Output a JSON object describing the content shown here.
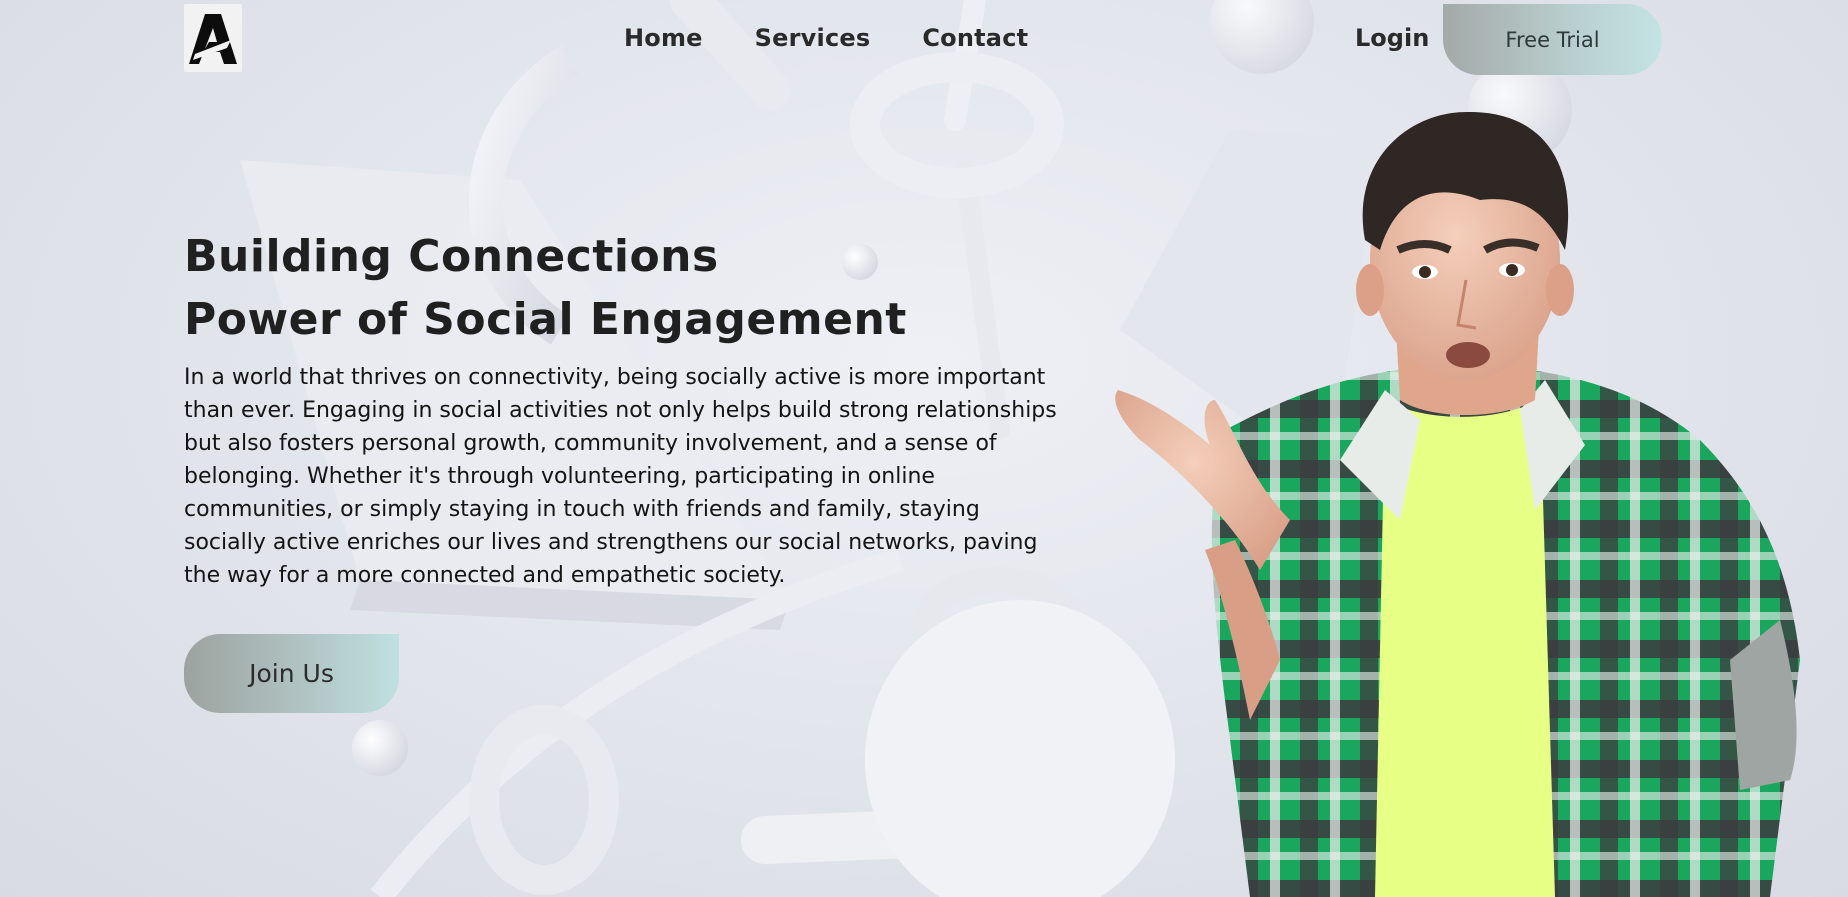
{
  "header": {
    "logo_alt": "A",
    "nav": [
      {
        "label": "Home"
      },
      {
        "label": "Services"
      },
      {
        "label": "Contact"
      }
    ],
    "login_label": "Login",
    "trial_label": "Free Trial"
  },
  "hero": {
    "title_line1": "Building Connections",
    "title_line2": "Power of Social Engagement",
    "description": "In a world that thrives on connectivity, being socially active is more important than ever. Engaging in social activities not only helps build strong relationships but also fosters personal growth, community involvement, and a sense of belonging. Whether it's through volunteering, participating in online communities, or simply staying in touch with friends and family, staying socially active enriches our lives and strengthens our social networks, paving the way for a more connected and empathetic society.",
    "cta_label": "Join Us"
  },
  "colors": {
    "background": "#e4e6ed",
    "button_start": "#a0a7a4",
    "button_end": "#c2e2e3",
    "shirt_green": "#16a85a",
    "tshirt": "#e9ff86"
  }
}
